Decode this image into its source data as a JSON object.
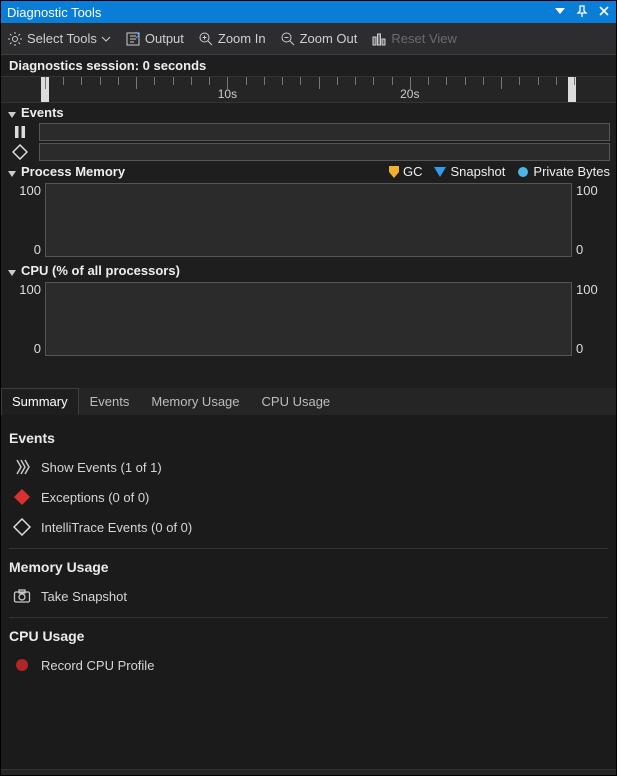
{
  "window": {
    "title": "Diagnostic Tools"
  },
  "toolbar": {
    "select_tools": "Select Tools",
    "output": "Output",
    "zoom_in": "Zoom In",
    "zoom_out": "Zoom Out",
    "reset_view": "Reset View"
  },
  "session": {
    "label": "Diagnostics session: 0 seconds"
  },
  "timeline": {
    "labels": [
      "10s",
      "20s"
    ]
  },
  "graphs": {
    "events": {
      "title": "Events"
    },
    "memory": {
      "title": "Process Memory",
      "legend": {
        "gc": "GC",
        "snapshot": "Snapshot",
        "private_bytes": "Private Bytes"
      },
      "ymax": "100",
      "ymin": "0"
    },
    "cpu": {
      "title": "CPU (% of all processors)",
      "ymax": "100",
      "ymin": "0"
    }
  },
  "tabs": {
    "summary": "Summary",
    "events": "Events",
    "memory": "Memory Usage",
    "cpu": "CPU Usage",
    "selected": "summary"
  },
  "summary": {
    "events": {
      "heading": "Events",
      "show_events": "Show Events (1 of 1)",
      "exceptions": "Exceptions (0 of 0)",
      "intellitrace": "IntelliTrace Events (0 of 0)"
    },
    "memory": {
      "heading": "Memory Usage",
      "take_snapshot": "Take Snapshot"
    },
    "cpu": {
      "heading": "CPU Usage",
      "record_profile": "Record CPU Profile"
    }
  },
  "chart_data": [
    {
      "type": "line",
      "title": "Process Memory",
      "xlabel": "s",
      "ylabel": "",
      "ylim": [
        0,
        100
      ],
      "x": [],
      "series": [
        {
          "name": "Private Bytes",
          "values": []
        }
      ],
      "markers": [
        {
          "name": "GC",
          "x": []
        },
        {
          "name": "Snapshot",
          "x": []
        }
      ]
    },
    {
      "type": "line",
      "title": "CPU (% of all processors)",
      "xlabel": "s",
      "ylabel": "%",
      "ylim": [
        0,
        100
      ],
      "x": [],
      "series": [
        {
          "name": "CPU",
          "values": []
        }
      ]
    }
  ]
}
